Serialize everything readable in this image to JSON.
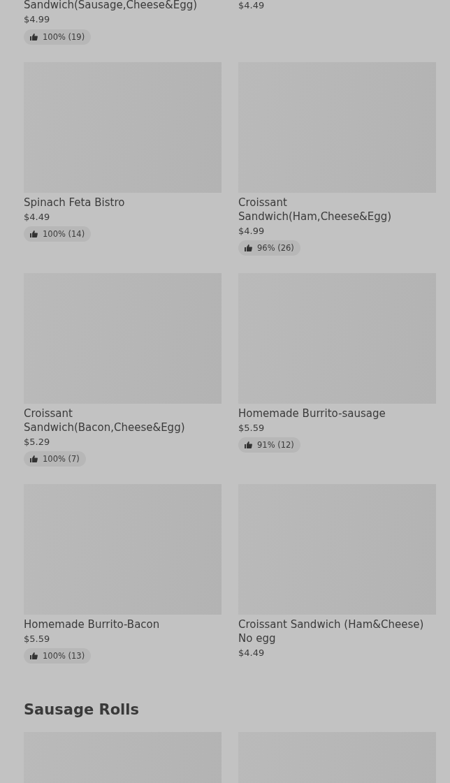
{
  "items": [
    {
      "kind": "partial",
      "name": "Sandwich(Sausage,Cheese&Egg)",
      "price": "$4.99",
      "rating": "100% (19)"
    },
    {
      "kind": "partial",
      "price": "$4.49"
    },
    {
      "kind": "full",
      "name": "Spinach Feta Bistro",
      "price": "$4.49",
      "rating": "100% (14)"
    },
    {
      "kind": "full",
      "name": "Croissant Sandwich(Ham,Cheese&Egg)",
      "price": "$4.99",
      "rating": "96% (26)"
    },
    {
      "kind": "full",
      "name": "Croissant Sandwich(Bacon,Cheese&Egg)",
      "price": "$5.29",
      "rating": "100% (7)"
    },
    {
      "kind": "full",
      "name": "Homemade Burrito-sausage",
      "price": "$5.59",
      "rating": "91% (12)"
    },
    {
      "kind": "full",
      "name": "Homemade Burrito-Bacon",
      "price": "$5.59",
      "rating": "100% (13)"
    },
    {
      "kind": "full",
      "name": "Croissant Sandwich (Ham&Cheese) No egg",
      "price": "$4.49"
    }
  ],
  "sections": [
    {
      "title": "Sausage Rolls",
      "items": [
        {
          "kind": "image"
        },
        {
          "kind": "image"
        }
      ]
    }
  ]
}
